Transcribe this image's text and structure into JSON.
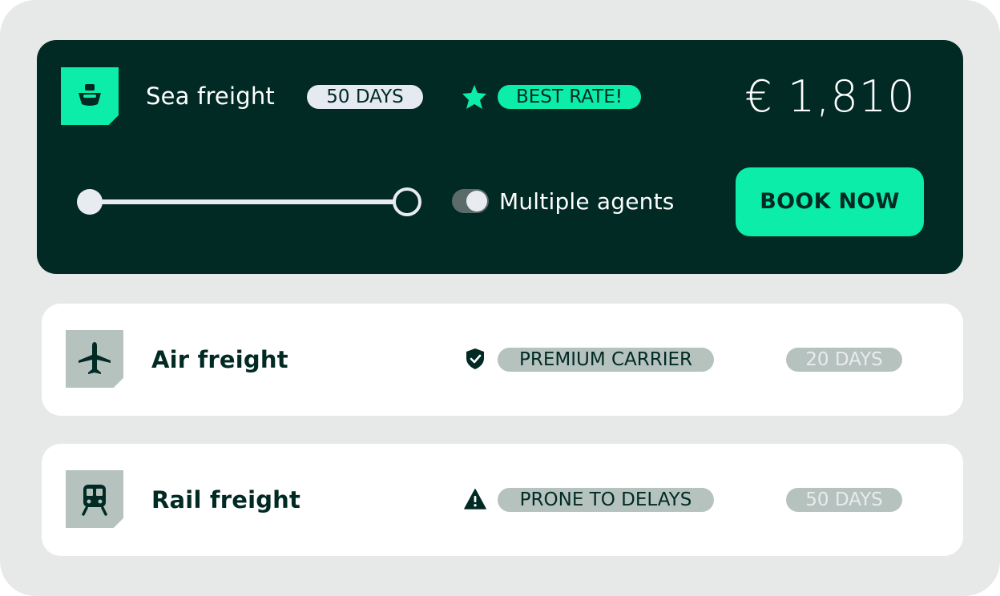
{
  "main_option": {
    "title": "Sea freight",
    "duration": "50 DAYS",
    "badge": "BEST RATE!",
    "price": "€ 1,810",
    "toggle_label": "Multiple agents",
    "toggle_on": true,
    "book_label": "BOOK NOW",
    "icon": "ship-icon"
  },
  "options": [
    {
      "title": "Air freight",
      "tag_icon": "shield-check-icon",
      "tag": "PREMIUM CARRIER",
      "duration": "20 DAYS",
      "icon": "airplane-icon"
    },
    {
      "title": "Rail freight",
      "tag_icon": "warning-icon",
      "tag": "PRONE TO DELAYS",
      "duration": "50 DAYS",
      "icon": "train-icon"
    }
  ],
  "colors": {
    "dark": "#012a24",
    "accent": "#0ceda9",
    "muted": "#b6c2be",
    "background": "#e6e9e7"
  }
}
